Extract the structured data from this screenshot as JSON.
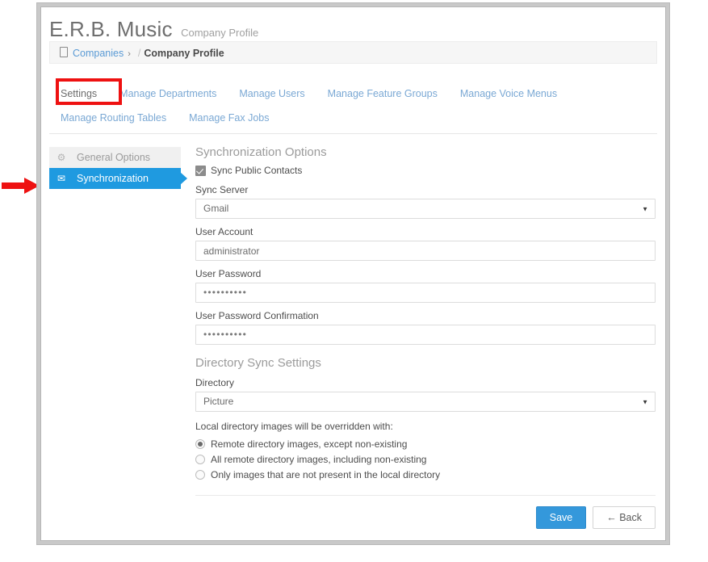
{
  "header": {
    "brand": "E.R.B. Music",
    "subtitle": "Company Profile"
  },
  "breadcrumb": {
    "icon": "document-icon",
    "root": "Companies",
    "caret": "›",
    "slash": "/",
    "current": "Company Profile"
  },
  "tabs": [
    {
      "label": "Settings",
      "active": true
    },
    {
      "label": "Manage Departments",
      "active": false
    },
    {
      "label": "Manage Users",
      "active": false
    },
    {
      "label": "Manage Feature Groups",
      "active": false
    },
    {
      "label": "Manage Voice Menus",
      "active": false
    },
    {
      "label": "Manage Routing Tables",
      "active": false
    },
    {
      "label": "Manage Fax Jobs",
      "active": false
    }
  ],
  "sidebar": {
    "items": [
      {
        "label": "General Options",
        "icon": "gear-icon",
        "glyph": "⚙",
        "active": false
      },
      {
        "label": "Synchronization",
        "icon": "envelope-icon",
        "glyph": "✉",
        "active": true
      }
    ]
  },
  "form": {
    "sync_section_title": "Synchronization Options",
    "sync_public_contacts_label": "Sync Public Contacts",
    "sync_public_contacts_checked": true,
    "sync_server_label": "Sync Server",
    "sync_server_value": "Gmail",
    "user_account_label": "User Account",
    "user_account_value": "administrator",
    "user_password_label": "User Password",
    "user_password_value": "••••••••••",
    "user_password_confirm_label": "User Password Confirmation",
    "user_password_confirm_value": "••••••••••",
    "directory_section_title": "Directory Sync Settings",
    "directory_label": "Directory",
    "directory_value": "Picture",
    "override_hint": "Local directory images will be overridden with:",
    "override_options": [
      {
        "label": "Remote directory images, except non-existing",
        "selected": true
      },
      {
        "label": "All remote directory images, including non-existing",
        "selected": false
      },
      {
        "label": "Only images that are not present in the local directory",
        "selected": false
      }
    ],
    "dropdown_caret": "▼"
  },
  "footer": {
    "save_label": "Save",
    "back_label": "← Back"
  },
  "annotations": {
    "highlight_color": "#ee1111",
    "highlight_target": "Settings",
    "arrow_target": "Synchronization"
  },
  "colors": {
    "accent_blue": "#1f9ae0",
    "button_blue": "#3498db",
    "link_blue": "#5b9bd5",
    "tab_blue": "#7aa8d4",
    "annotation_red": "#ee1111"
  }
}
